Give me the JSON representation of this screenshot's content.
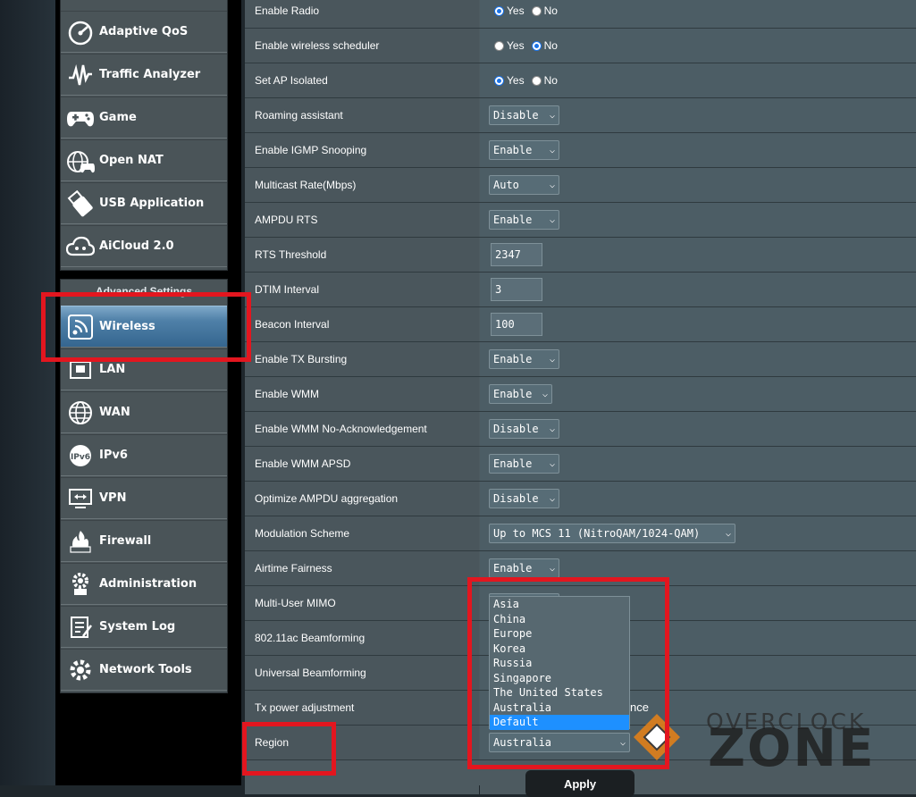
{
  "sidebar": {
    "top_items": [
      {
        "label": "Adaptive QoS",
        "icon": "gauge-icon"
      },
      {
        "label": "Traffic Analyzer",
        "icon": "waveform-icon"
      },
      {
        "label": "Game",
        "icon": "gamepad-icon"
      },
      {
        "label": "Open NAT",
        "icon": "globe-gamepad-icon"
      },
      {
        "label": "USB Application",
        "icon": "usb-icon"
      },
      {
        "label": "AiCloud 2.0",
        "icon": "cloud-icon"
      }
    ],
    "advanced_title": "Advanced Settings",
    "advanced_items": [
      {
        "label": "Wireless",
        "icon": "wifi-icon",
        "active": true
      },
      {
        "label": "LAN",
        "icon": "lan-icon"
      },
      {
        "label": "WAN",
        "icon": "globe-icon"
      },
      {
        "label": "IPv6",
        "icon": "ipv6-icon"
      },
      {
        "label": "VPN",
        "icon": "vpn-icon"
      },
      {
        "label": "Firewall",
        "icon": "firewall-icon"
      },
      {
        "label": "Administration",
        "icon": "admin-gear-icon"
      },
      {
        "label": "System Log",
        "icon": "system-log-icon"
      },
      {
        "label": "Network Tools",
        "icon": "network-tools-icon"
      }
    ]
  },
  "settings": {
    "enable_radio": {
      "label": "Enable Radio",
      "yes": "Yes",
      "no": "No",
      "selected": "Yes"
    },
    "wireless_scheduler": {
      "label": "Enable wireless scheduler",
      "yes": "Yes",
      "no": "No",
      "selected": "No"
    },
    "ap_isolated": {
      "label": "Set AP Isolated",
      "yes": "Yes",
      "no": "No",
      "selected": "Yes"
    },
    "roaming_assistant": {
      "label": "Roaming assistant",
      "value": "Disable"
    },
    "igmp_snooping": {
      "label": "Enable IGMP Snooping",
      "value": "Enable"
    },
    "multicast_rate": {
      "label": "Multicast Rate(Mbps)",
      "value": "Auto"
    },
    "ampdu_rts": {
      "label": "AMPDU RTS",
      "value": "Enable"
    },
    "rts_threshold": {
      "label": "RTS Threshold",
      "value": "2347"
    },
    "dtim_interval": {
      "label": "DTIM Interval",
      "value": "3"
    },
    "beacon_interval": {
      "label": "Beacon Interval",
      "value": "100"
    },
    "tx_bursting": {
      "label": "Enable TX Bursting",
      "value": "Enable"
    },
    "wmm": {
      "label": "Enable WMM",
      "value": "Enable"
    },
    "wmm_noack": {
      "label": "Enable WMM No-Acknowledgement",
      "value": "Disable"
    },
    "wmm_apsd": {
      "label": "Enable WMM APSD",
      "value": "Enable"
    },
    "ampdu_aggregation": {
      "label": "Optimize AMPDU aggregation",
      "value": "Disable"
    },
    "modulation_scheme": {
      "label": "Modulation Scheme",
      "value": "Up to MCS 11 (NitroQAM/1024-QAM)"
    },
    "airtime_fairness": {
      "label": "Airtime Fairness",
      "value": "Enable"
    },
    "mu_mimo": {
      "label": "Multi-User MIMO",
      "value": ""
    },
    "beamforming_ac": {
      "label": "802.11ac Beamforming"
    },
    "universal_beamforming": {
      "label": "Universal Beamforming"
    },
    "tx_power": {
      "label": "Tx power adjustment",
      "value_fragment": "nce"
    },
    "region": {
      "label": "Region",
      "value": "Australia",
      "options": [
        "Asia",
        "China",
        "Europe",
        "Korea",
        "Russia",
        "Singapore",
        "The United States",
        "Australia",
        "Default"
      ],
      "highlighted": "Default"
    }
  },
  "apply_label": "Apply",
  "watermark": {
    "line1": "OVERCLOCK",
    "line2": "ZONE"
  },
  "colors": {
    "highlight_red": "#e3161f",
    "active_blue": "#35668f",
    "selected_option": "#1e90ff"
  }
}
